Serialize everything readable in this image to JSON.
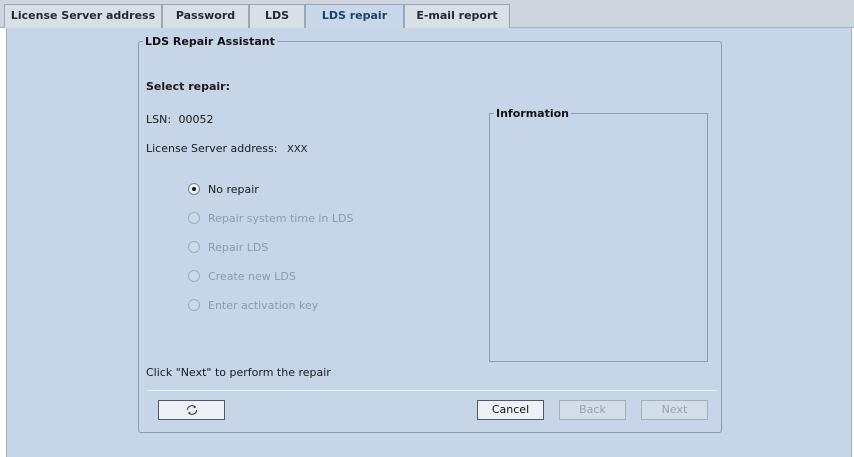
{
  "tabs": [
    {
      "label": "License Server address"
    },
    {
      "label": "Password"
    },
    {
      "label": "LDS"
    },
    {
      "label": "LDS repair"
    },
    {
      "label": "E-mail report"
    }
  ],
  "assistant": {
    "legend": "LDS Repair Assistant",
    "select_repair": "Select repair:",
    "lsn_label": "LSN:",
    "lsn_value": "00052",
    "server_label": "License Server address:",
    "server_value": "XXX",
    "options": [
      {
        "label": "No repair",
        "selected": true,
        "enabled": true
      },
      {
        "label": "Repair system time in LDS",
        "selected": false,
        "enabled": false
      },
      {
        "label": "Repair LDS",
        "selected": false,
        "enabled": false
      },
      {
        "label": "Create new LDS",
        "selected": false,
        "enabled": false
      },
      {
        "label": "Enter activation key",
        "selected": false,
        "enabled": false
      }
    ],
    "info_legend": "Information",
    "hint": "Click \"Next\" to perform the repair"
  },
  "buttons": {
    "refresh_icon": "refresh-icon",
    "cancel": "Cancel",
    "back": "Back",
    "next": "Next"
  }
}
